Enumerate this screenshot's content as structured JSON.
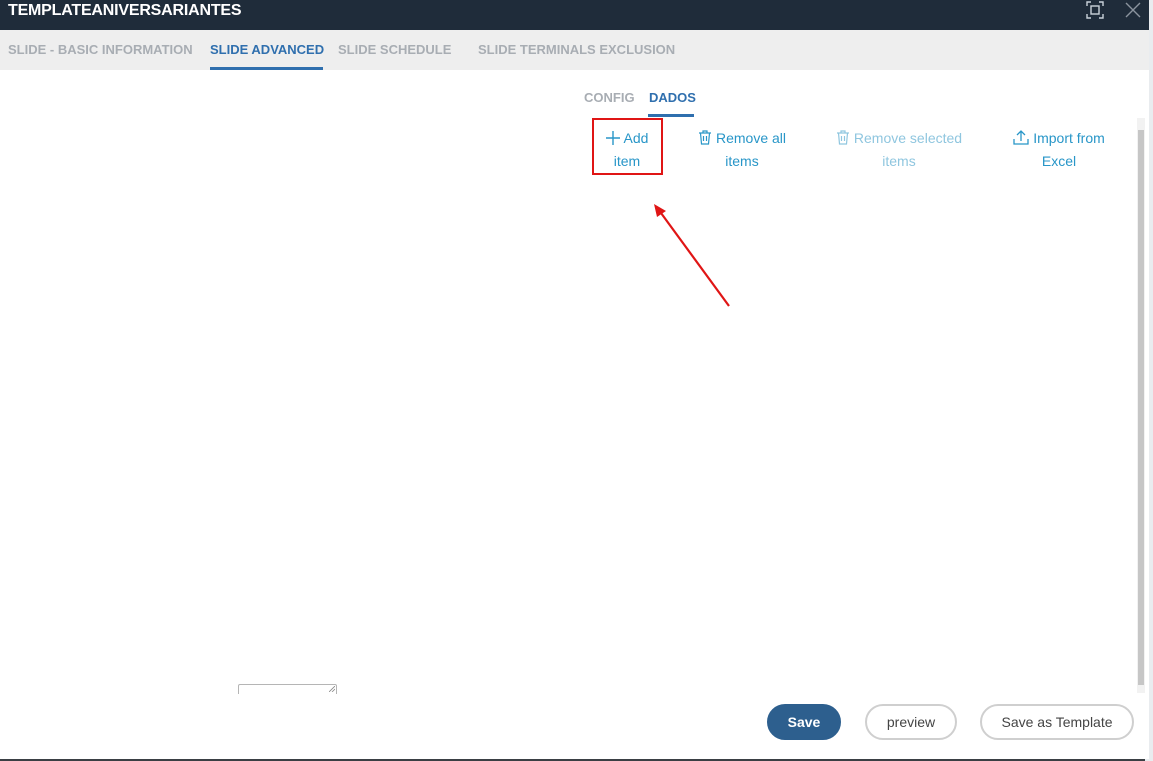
{
  "window": {
    "title": "TEMPLATEANIVERSARIANTES"
  },
  "tabs": [
    {
      "label": "SLIDE - BASIC INFORMATION",
      "active": false
    },
    {
      "label": "SLIDE ADVANCED",
      "active": true
    },
    {
      "label": "SLIDE SCHEDULE",
      "active": false
    },
    {
      "label": "SLIDE TERMINALS EXCLUSION",
      "active": false
    }
  ],
  "subtabs": [
    {
      "label": "CONFIG",
      "active": false
    },
    {
      "label": "DADOS",
      "active": true
    }
  ],
  "actions": {
    "add_item": {
      "line1": "Add",
      "line2": "item",
      "icon": "plus-icon"
    },
    "remove_all": {
      "line1": "Remove all",
      "line2": "items",
      "icon": "trash-icon"
    },
    "remove_selected": {
      "line1": "Remove selected",
      "line2": "items",
      "icon": "trash-icon",
      "disabled": true
    },
    "import_excel": {
      "line1": "Import from",
      "line2": "Excel",
      "icon": "upload-icon"
    }
  },
  "footer": {
    "save_label": "Save",
    "preview_label": "preview",
    "save_template_label": "Save as Template"
  },
  "colors": {
    "titlebar": "#1f2c3a",
    "accent": "#2f6fae",
    "action_link": "#2896c8",
    "highlight": "#e01515",
    "save_button": "#2d5f8e"
  }
}
